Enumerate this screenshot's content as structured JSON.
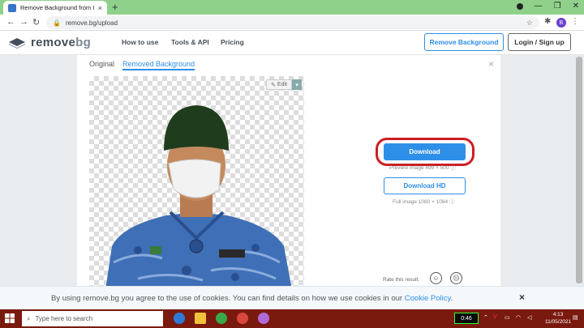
{
  "browser": {
    "tab_title": "Remove Background from Imag",
    "tab_close": "×",
    "new_tab": "+",
    "url": "remove.bg/upload",
    "profile_initial": "B"
  },
  "site": {
    "logo_part1": "remove",
    "logo_part2": "bg",
    "nav": [
      "How to use",
      "Tools & API",
      "Pricing"
    ],
    "remove_bg_button": "Remove Background",
    "login_button": "Login / Sign up"
  },
  "editor": {
    "tab_original": "Original",
    "tab_removed": "Removed Background",
    "close": "×",
    "edit_label": "Edit",
    "download_label": "Download",
    "preview_meta": "Preview image 499 × 500",
    "download_hd_label": "Download HD",
    "full_meta": "Full image 1080 × 1084",
    "rate_label": "Rate this result:",
    "happy_face": "☺",
    "sad_face": "☹"
  },
  "cookie": {
    "text": "By using remove.bg you agree to the use of cookies. You can find details on how we use cookies in our",
    "link": "Cookie Policy",
    "period": ".",
    "close": "×"
  },
  "taskbar": {
    "search_placeholder": "Type here to search",
    "battery": "0:46",
    "time": "4:13",
    "date": "11/05/2021"
  },
  "colors": {
    "accent": "#2d8fe8",
    "highlight": "#cc1e22",
    "taskbar": "#7a1a0f",
    "chrome": "#8fd18a"
  }
}
